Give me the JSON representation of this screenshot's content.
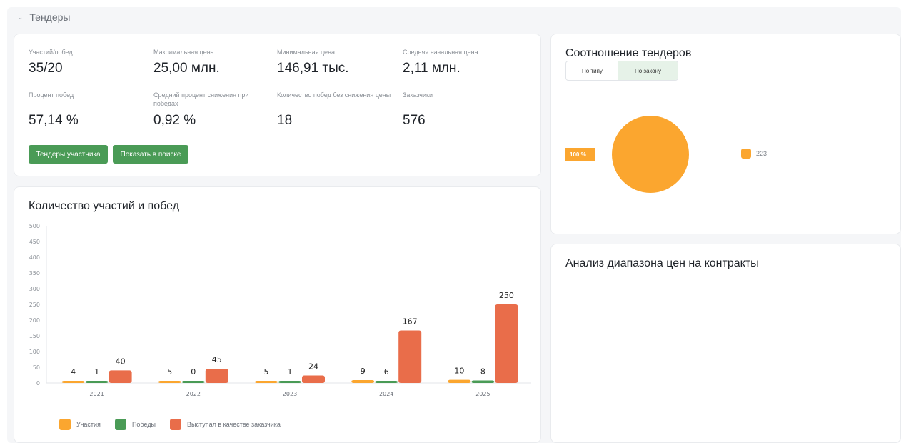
{
  "section": {
    "title": "Тендеры"
  },
  "stats": [
    {
      "label": "Участий/побед",
      "value": "35/20"
    },
    {
      "label": "Максимальная цена",
      "value": "25,00 млн."
    },
    {
      "label": "Минимальная цена",
      "value": "146,91 тыс."
    },
    {
      "label": "Средняя начальная цена",
      "value": "2,11 млн."
    },
    {
      "label": "Процент побед",
      "value": "57,14 %"
    },
    {
      "label": "Средний процент снижения при победах",
      "value": "0,92 %"
    },
    {
      "label": "Количество побед без снижения цены",
      "value": "18"
    },
    {
      "label": "Заказчики",
      "value": "576"
    }
  ],
  "buttons": {
    "participant_tenders": "Тендеры участника",
    "show_in_search": "Показать в поиске"
  },
  "ratio": {
    "title": "Соотношение тендеров",
    "tabs": [
      "По типу",
      "По закону"
    ],
    "active_tab": "По закону",
    "percent_label": "100 %",
    "legend_value": "223",
    "color": "#fba62f"
  },
  "range": {
    "title": "Анализ диапазона цен на контракты"
  },
  "bar_chart": {
    "title": "Количество участий и побед"
  },
  "chart_data": {
    "type": "bar",
    "categories": [
      "2021",
      "2022",
      "2023",
      "2024",
      "2025"
    ],
    "series": [
      {
        "name": "Участия",
        "color": "#fba62f",
        "values": [
          4,
          5,
          5,
          9,
          10
        ]
      },
      {
        "name": "Победы",
        "color": "#4a9b56",
        "values": [
          1,
          0,
          1,
          6,
          8
        ]
      },
      {
        "name": "Выступал в качестве заказчика",
        "color": "#e96d4a",
        "values": [
          40,
          45,
          24,
          167,
          250
        ]
      }
    ],
    "ylim": [
      0,
      500
    ],
    "yticks": [
      0,
      50,
      100,
      150,
      200,
      250,
      300,
      350,
      400,
      450,
      500
    ],
    "legend_position": "bottom-left",
    "data_labels": true
  }
}
